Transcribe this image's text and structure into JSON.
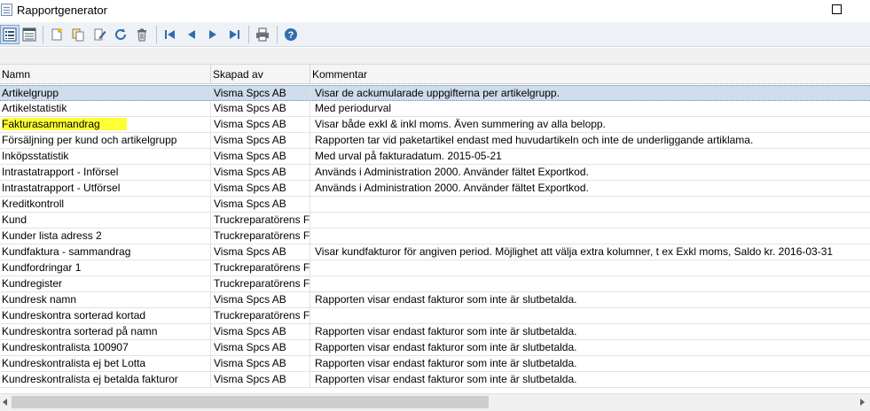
{
  "window": {
    "title": "Rapportgenerator"
  },
  "toolbar": {
    "buttons": [
      {
        "name": "list-view-icon"
      },
      {
        "name": "detail-view-icon"
      },
      {
        "name": "new-report-icon"
      },
      {
        "name": "copy-report-icon"
      },
      {
        "name": "edit-report-icon"
      },
      {
        "name": "refresh-icon"
      },
      {
        "name": "delete-icon"
      },
      {
        "name": "first-record-icon"
      },
      {
        "name": "previous-record-icon"
      },
      {
        "name": "next-record-icon"
      },
      {
        "name": "last-record-icon"
      },
      {
        "name": "print-icon"
      },
      {
        "name": "help-icon"
      }
    ]
  },
  "grid": {
    "columns": [
      "Namn",
      "Skapad av",
      "Kommentar"
    ],
    "selected_row": 0,
    "highlighted_row": 2,
    "highlight_color": "#ffff33",
    "rows": [
      [
        "Artikelgrupp",
        "Visma Spcs AB",
        "Visar de ackumularade uppgifterna per artikelgrupp."
      ],
      [
        "Artikelstatistik",
        "Visma Spcs AB",
        "Med periodurval"
      ],
      [
        "Fakturasammandrag",
        "Visma Spcs AB",
        "Visar både exkl & inkl moms. Även summering av alla belopp."
      ],
      [
        "Försäljning per kund och artikelgrupp",
        "Visma Spcs AB",
        "Rapporten tar vid paketartikel endast med huvudartikeln och inte de underliggande artiklama."
      ],
      [
        "Inköpsstatistik",
        "Visma Spcs AB",
        "Med urval på fakturadatum. 2015-05-21"
      ],
      [
        "Intrastatrapport - Införsel",
        "Visma Spcs AB",
        "Används i Administration 2000. Använder fältet Exportkod."
      ],
      [
        "Intrastatrapport - Utförsel",
        "Visma Spcs AB",
        "Används i Administration 2000. Använder fältet Exportkod."
      ],
      [
        "Kreditkontroll",
        "Visma Spcs AB",
        ""
      ],
      [
        "Kund",
        "Truckreparatörens Fön",
        ""
      ],
      [
        "Kunder lista adress 2",
        "Truckreparatörens Fön",
        ""
      ],
      [
        "Kundfaktura - sammandrag",
        "Visma Spcs AB",
        "Visar kundfakturor för angiven period. Möjlighet att välja extra kolumner, t ex Exkl moms, Saldo kr. 2016-03-31"
      ],
      [
        "Kundfordringar 1",
        "Truckreparatörens Fön",
        ""
      ],
      [
        "Kundregister",
        "Truckreparatörens Fön",
        ""
      ],
      [
        "Kundresk namn",
        "Visma Spcs AB",
        "Rapporten visar endast fakturor som inte är slutbetalda."
      ],
      [
        "Kundreskontra sorterad kortad",
        "Truckreparatörens Fön",
        ""
      ],
      [
        "Kundreskontra sorterad på namn",
        "Visma Spcs AB",
        "Rapporten visar endast fakturor som inte är slutbetalda."
      ],
      [
        "Kundreskontralista 100907",
        "Visma Spcs AB",
        "Rapporten visar endast fakturor som inte är slutbetalda."
      ],
      [
        "Kundreskontralista ej bet Lotta",
        "Visma Spcs AB",
        "Rapporten visar endast fakturor som inte är slutbetalda."
      ],
      [
        "Kundreskontralista ej betalda fakturor",
        "Visma Spcs AB",
        "Rapporten visar endast fakturor som inte är slutbetalda."
      ]
    ]
  },
  "scrollbar": {
    "horizontal_position": 0.0
  }
}
